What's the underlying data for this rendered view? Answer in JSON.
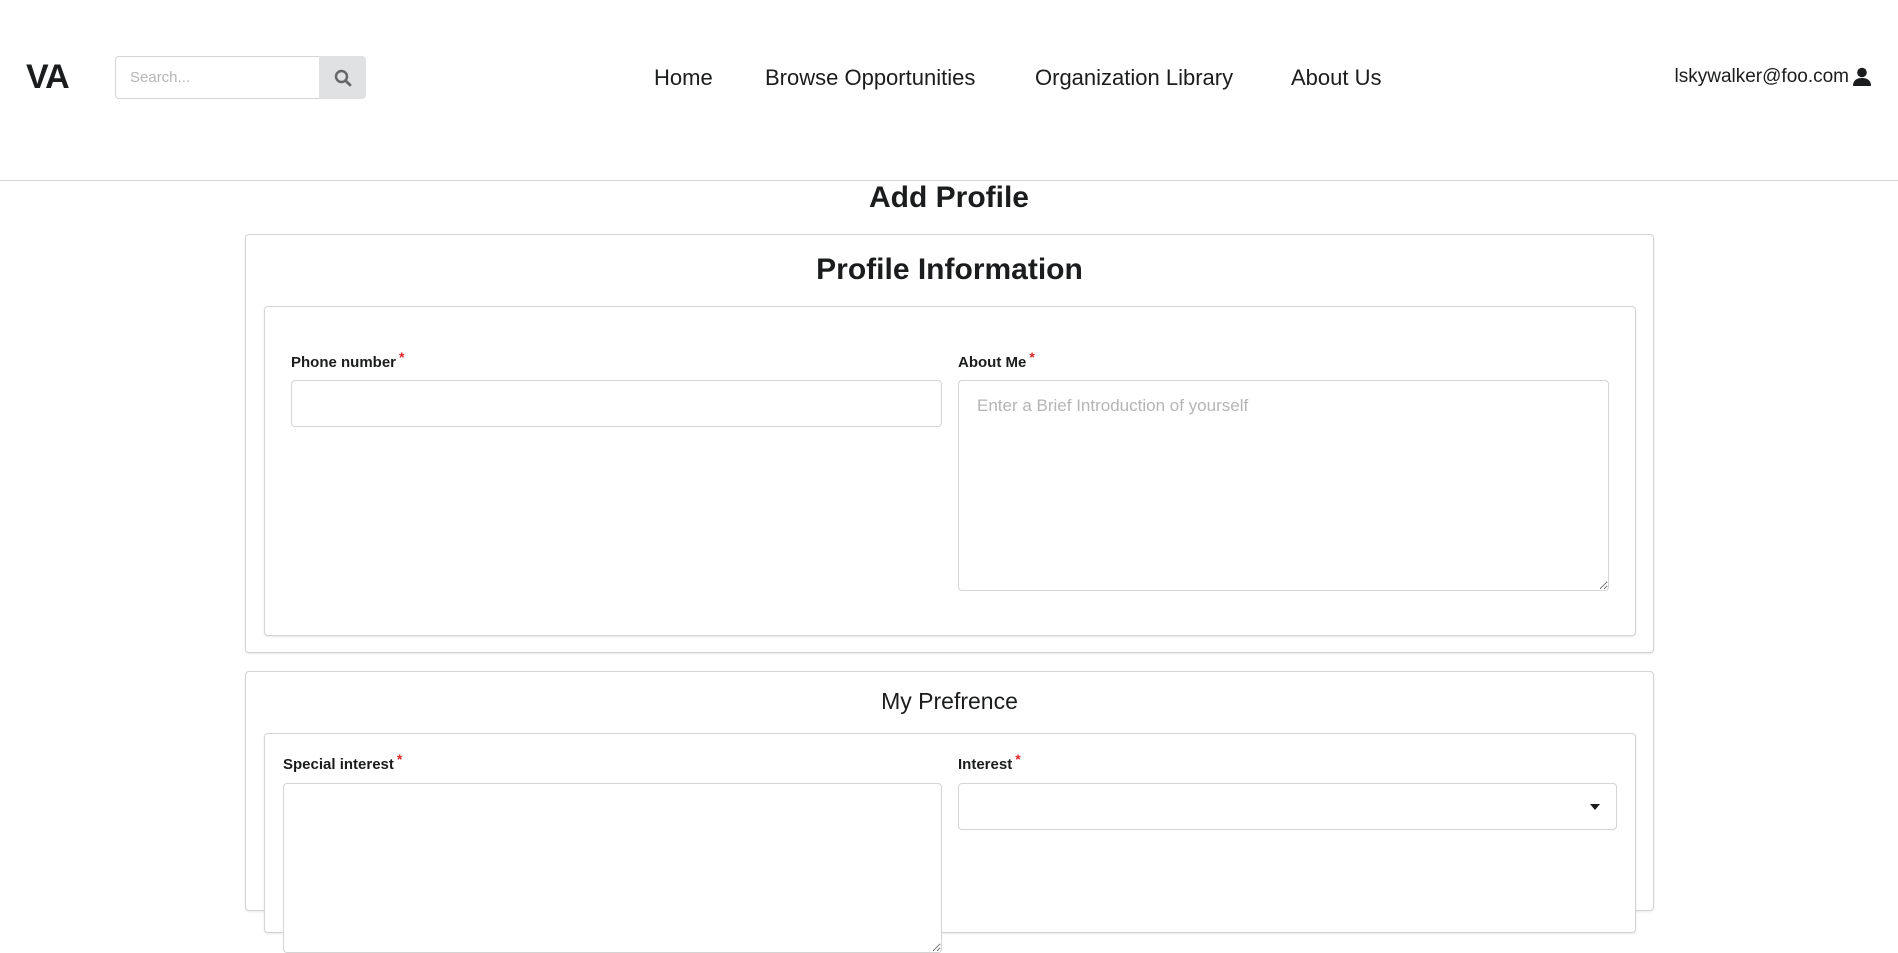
{
  "header": {
    "logo": "VA",
    "search": {
      "placeholder": "Search...",
      "value": ""
    },
    "nav": [
      {
        "label": "Home"
      },
      {
        "label": "Browse Opportunities"
      },
      {
        "label": "Organization Library"
      },
      {
        "label": "About Us"
      }
    ],
    "user": {
      "email": "lskywalker@foo.com"
    }
  },
  "page": {
    "title": "Add Profile",
    "profile_section": {
      "title": "Profile Information",
      "phone": {
        "label": "Phone number",
        "required_mark": "*",
        "value": ""
      },
      "about": {
        "label": "About Me",
        "required_mark": "*",
        "placeholder": "Enter a Brief Introduction of yourself",
        "value": ""
      }
    },
    "preference_section": {
      "title": "My Prefrence",
      "special_interest": {
        "label": "Special interest",
        "required_mark": "*",
        "value": ""
      },
      "interest": {
        "label": "Interest",
        "required_mark": "*",
        "selected": ""
      }
    }
  },
  "colors": {
    "required": "#db2828",
    "border": "#d4d4d5",
    "search_button_bg": "#e0e1e2",
    "text": "#1b1c1d"
  }
}
